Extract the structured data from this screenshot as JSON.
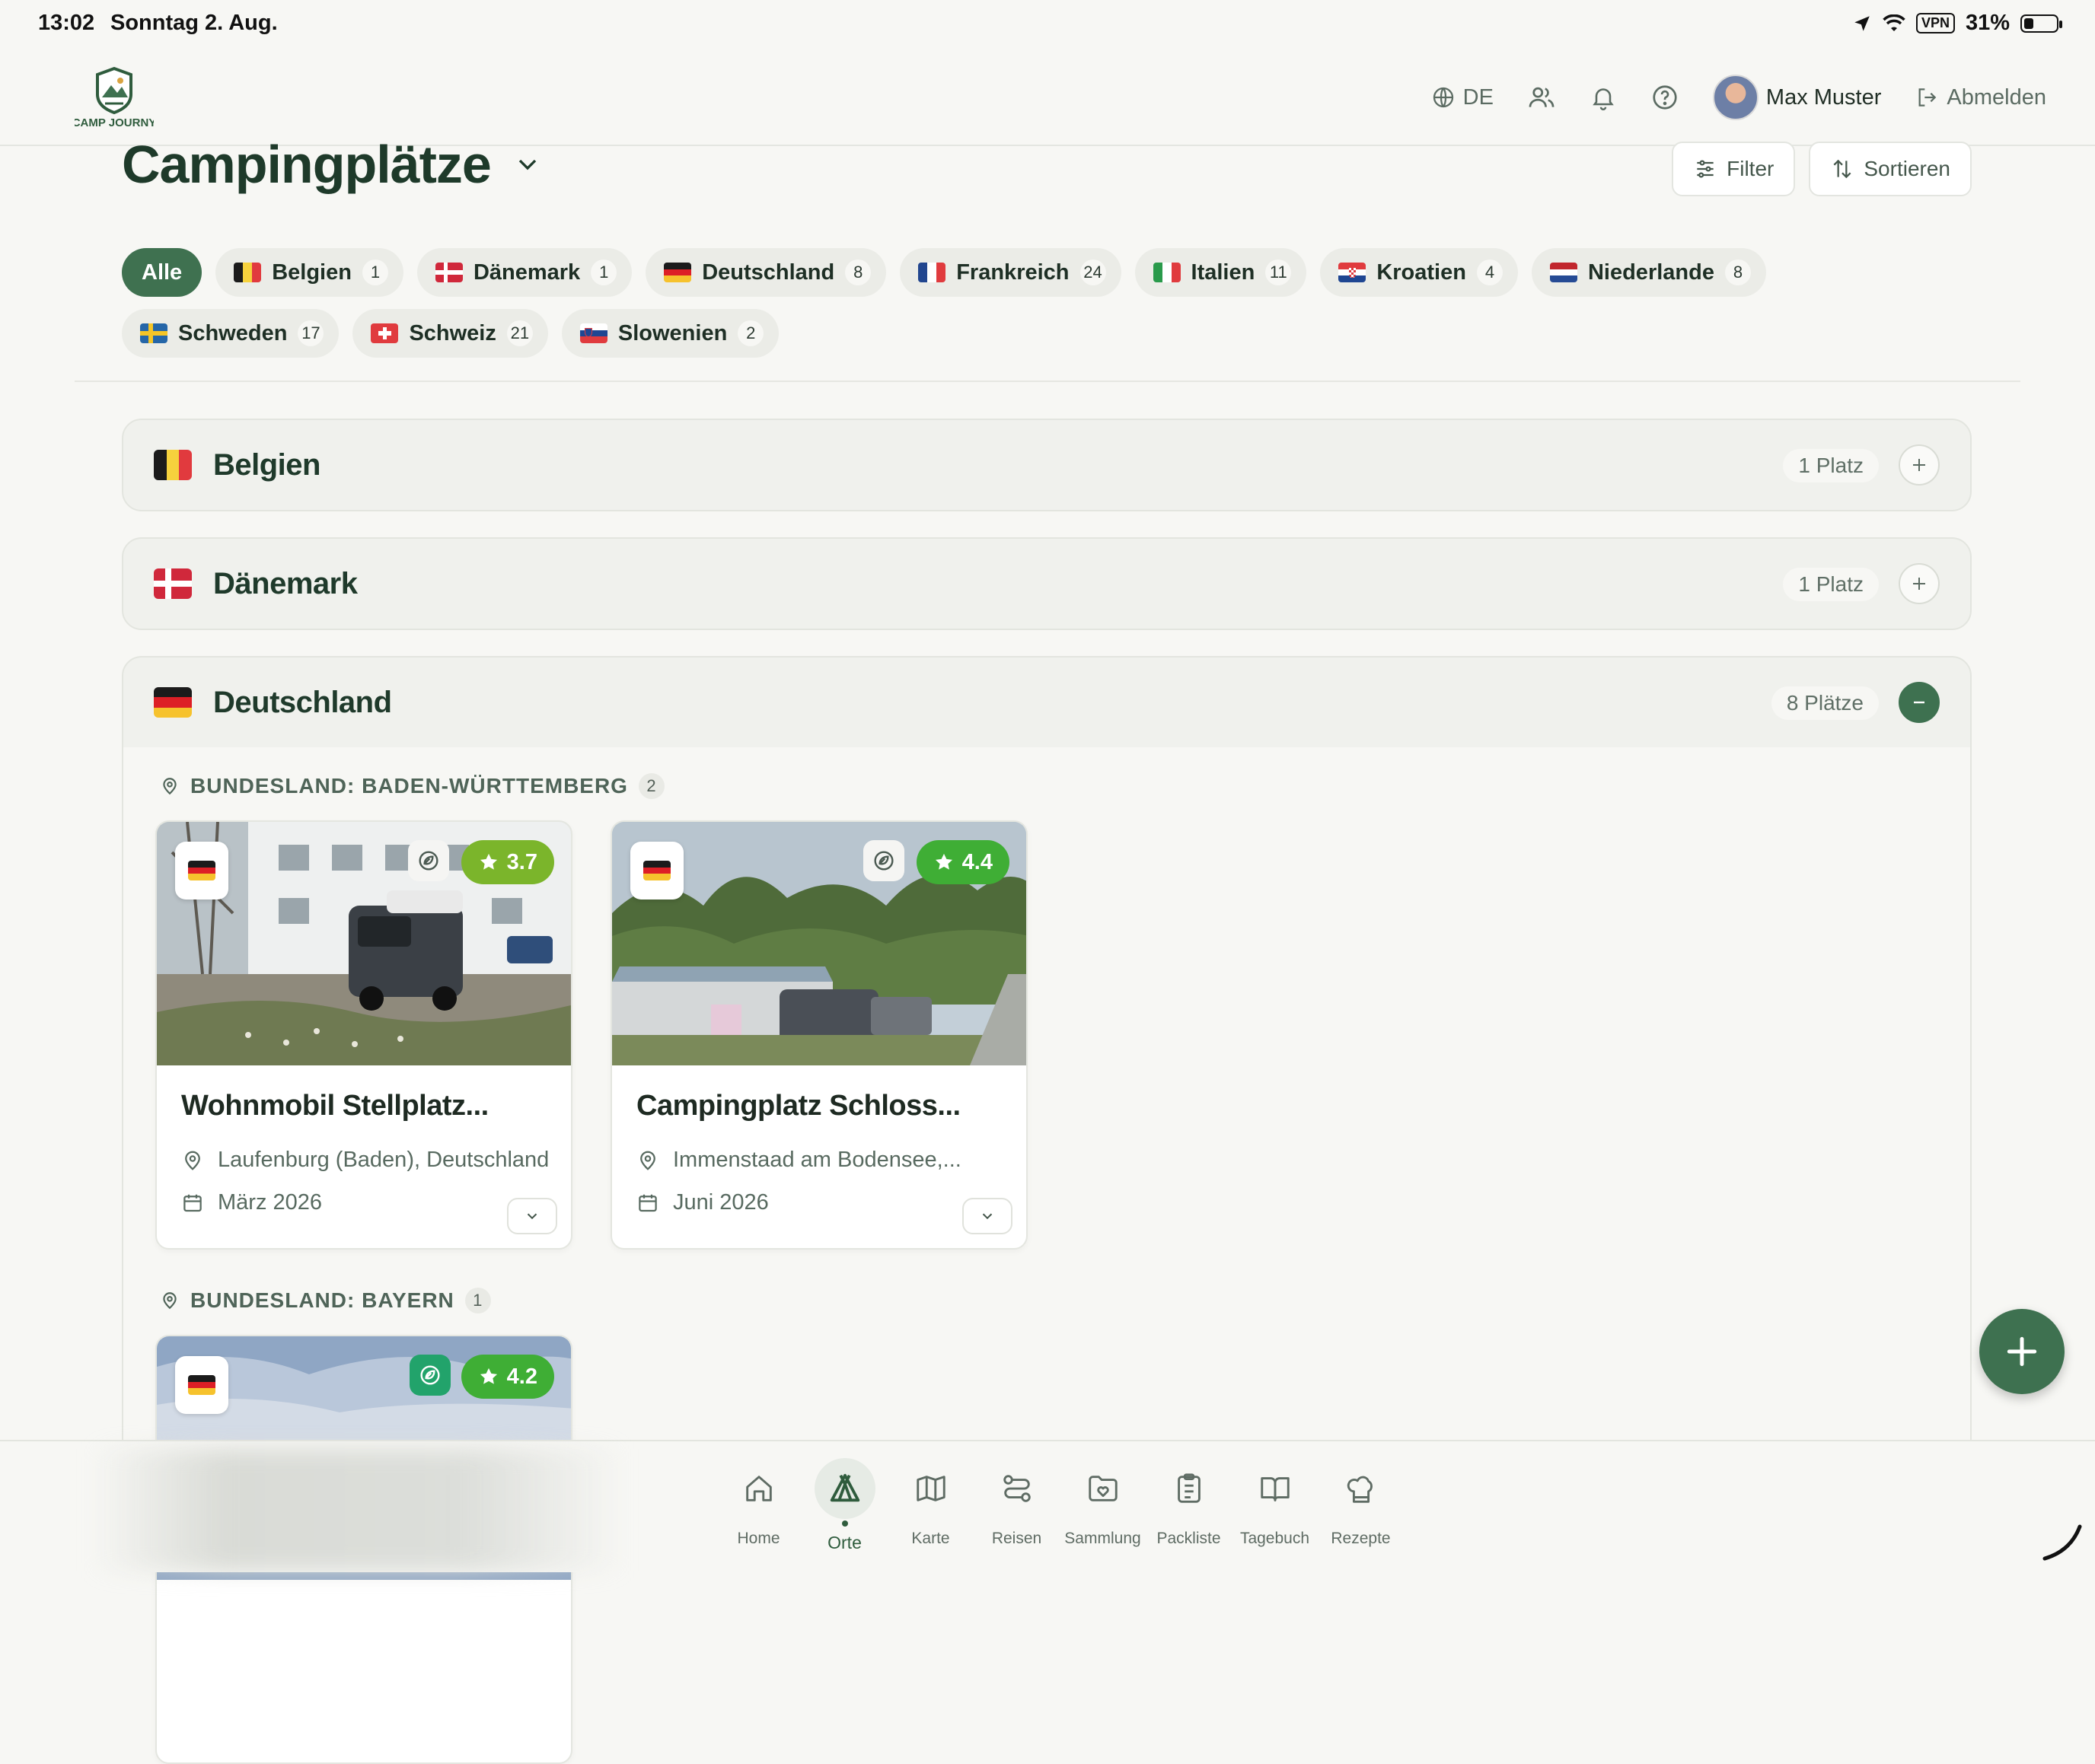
{
  "status": {
    "time": "13:02",
    "date": "Sonntag 2. Aug.",
    "vpn": "VPN",
    "battery": "31%",
    "battery_fraction": 0.31
  },
  "header": {
    "language": "DE",
    "user_name": "Max Muster",
    "logout_label": "Abmelden",
    "logo_text": "CAMP JOURNY"
  },
  "page": {
    "title": "Campingplätze",
    "filter_label": "Filter",
    "sort_label": "Sortieren"
  },
  "chips": [
    {
      "label": "Alle",
      "count": "",
      "flag": "",
      "active": true
    },
    {
      "label": "Belgien",
      "count": "1",
      "flag": "be"
    },
    {
      "label": "Dänemark",
      "count": "1",
      "flag": "dk"
    },
    {
      "label": "Deutschland",
      "count": "8",
      "flag": "de"
    },
    {
      "label": "Frankreich",
      "count": "24",
      "flag": "fr"
    },
    {
      "label": "Italien",
      "count": "11",
      "flag": "it"
    },
    {
      "label": "Kroatien",
      "count": "4",
      "flag": "hr"
    },
    {
      "label": "Niederlande",
      "count": "8",
      "flag": "nl"
    },
    {
      "label": "Schweden",
      "count": "17",
      "flag": "se"
    },
    {
      "label": "Schweiz",
      "count": "21",
      "flag": "ch"
    },
    {
      "label": "Slowenien",
      "count": "2",
      "flag": "si"
    }
  ],
  "sections": [
    {
      "country": "Belgien",
      "flag": "be",
      "count_label": "1 Platz",
      "expanded": false
    },
    {
      "country": "Dänemark",
      "flag": "dk",
      "count_label": "1 Platz",
      "expanded": false
    },
    {
      "country": "Deutschland",
      "flag": "de",
      "count_label": "8 Plätze",
      "expanded": true
    }
  ],
  "regions": [
    {
      "label": "BUNDESLAND: BADEN-WÜRTTEMBERG",
      "count": "2"
    },
    {
      "label": "BUNDESLAND: BAYERN",
      "count": "1"
    }
  ],
  "cards": [
    {
      "title": "Wohnmobil Stellplatz...",
      "location": "Laufenburg (Baden), Deutschland",
      "date": "März 2026",
      "rating": "3.7",
      "eco_icon": "leaf-badge-icon"
    },
    {
      "title": "Campingplatz Schloss...",
      "location": "Immenstaad am Bodensee,...",
      "date": "Juni 2026",
      "rating": "4.4",
      "eco_icon": "leaf-badge-icon"
    },
    {
      "title": "",
      "location": "",
      "date": "",
      "rating": "4.2",
      "eco_icon": "leaf-badge-icon"
    }
  ],
  "nav": [
    {
      "label": "Home",
      "icon": "home-icon"
    },
    {
      "label": "Orte",
      "icon": "tent-icon",
      "active": true
    },
    {
      "label": "Karte",
      "icon": "map-icon"
    },
    {
      "label": "Reisen",
      "icon": "route-icon"
    },
    {
      "label": "Sammlung",
      "icon": "folder-heart-icon"
    },
    {
      "label": "Packliste",
      "icon": "clipboard-icon"
    },
    {
      "label": "Tagebuch",
      "icon": "book-icon"
    },
    {
      "label": "Rezepte",
      "icon": "chef-hat-icon"
    }
  ],
  "colors": {
    "accent": "#3e7150",
    "background": "#f7f7f4",
    "rating_lime": "#7bb52b",
    "rating_green": "#3fae35"
  }
}
